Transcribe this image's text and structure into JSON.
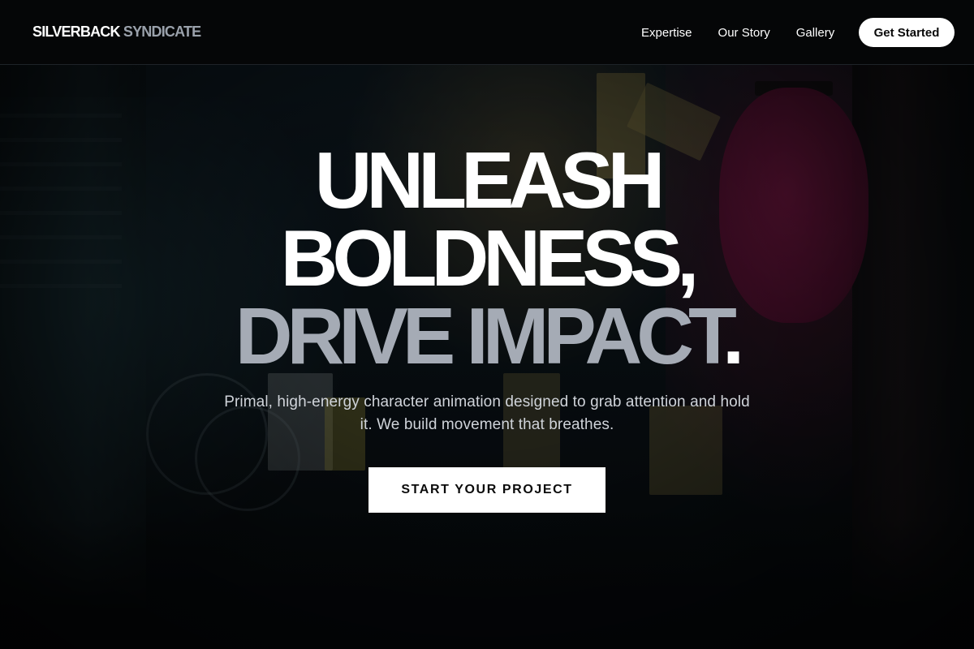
{
  "brand": {
    "name_part1": "SILVERBACK",
    "name_part2": "SYNDICATE"
  },
  "nav": {
    "items": [
      {
        "label": "Expertise"
      },
      {
        "label": "Our Story"
      },
      {
        "label": "Gallery"
      }
    ],
    "cta_label": "Get Started"
  },
  "hero": {
    "headline_line1": "UNLEASH",
    "headline_line2": "BOLDNESS,",
    "headline_line3": "DRIVE IMPACT",
    "headline_period": ".",
    "subtitle": "Primal, high-energy character animation designed to grab attention and hold it. We build movement that breathes.",
    "cta_label": "START YOUR PROJECT",
    "background_description_icon": "night-alley-photo"
  },
  "colors": {
    "background": "#050607",
    "headline_primary": "#ffffff",
    "headline_secondary": "#a5abb5",
    "subtitle": "#cfd3d9",
    "button_bg": "#ffffff",
    "button_text": "#0b0b0b"
  }
}
